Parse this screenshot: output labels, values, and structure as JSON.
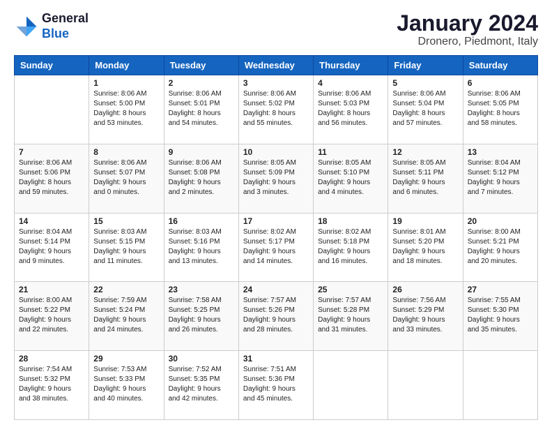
{
  "logo": {
    "line1": "General",
    "line2": "Blue"
  },
  "title": "January 2024",
  "subtitle": "Dronero, Piedmont, Italy",
  "days_header": [
    "Sunday",
    "Monday",
    "Tuesday",
    "Wednesday",
    "Thursday",
    "Friday",
    "Saturday"
  ],
  "weeks": [
    [
      {
        "day": "",
        "info": ""
      },
      {
        "day": "1",
        "info": "Sunrise: 8:06 AM\nSunset: 5:00 PM\nDaylight: 8 hours\nand 53 minutes."
      },
      {
        "day": "2",
        "info": "Sunrise: 8:06 AM\nSunset: 5:01 PM\nDaylight: 8 hours\nand 54 minutes."
      },
      {
        "day": "3",
        "info": "Sunrise: 8:06 AM\nSunset: 5:02 PM\nDaylight: 8 hours\nand 55 minutes."
      },
      {
        "day": "4",
        "info": "Sunrise: 8:06 AM\nSunset: 5:03 PM\nDaylight: 8 hours\nand 56 minutes."
      },
      {
        "day": "5",
        "info": "Sunrise: 8:06 AM\nSunset: 5:04 PM\nDaylight: 8 hours\nand 57 minutes."
      },
      {
        "day": "6",
        "info": "Sunrise: 8:06 AM\nSunset: 5:05 PM\nDaylight: 8 hours\nand 58 minutes."
      }
    ],
    [
      {
        "day": "7",
        "info": "Sunrise: 8:06 AM\nSunset: 5:06 PM\nDaylight: 8 hours\nand 59 minutes."
      },
      {
        "day": "8",
        "info": "Sunrise: 8:06 AM\nSunset: 5:07 PM\nDaylight: 9 hours\nand 0 minutes."
      },
      {
        "day": "9",
        "info": "Sunrise: 8:06 AM\nSunset: 5:08 PM\nDaylight: 9 hours\nand 2 minutes."
      },
      {
        "day": "10",
        "info": "Sunrise: 8:05 AM\nSunset: 5:09 PM\nDaylight: 9 hours\nand 3 minutes."
      },
      {
        "day": "11",
        "info": "Sunrise: 8:05 AM\nSunset: 5:10 PM\nDaylight: 9 hours\nand 4 minutes."
      },
      {
        "day": "12",
        "info": "Sunrise: 8:05 AM\nSunset: 5:11 PM\nDaylight: 9 hours\nand 6 minutes."
      },
      {
        "day": "13",
        "info": "Sunrise: 8:04 AM\nSunset: 5:12 PM\nDaylight: 9 hours\nand 7 minutes."
      }
    ],
    [
      {
        "day": "14",
        "info": "Sunrise: 8:04 AM\nSunset: 5:14 PM\nDaylight: 9 hours\nand 9 minutes."
      },
      {
        "day": "15",
        "info": "Sunrise: 8:03 AM\nSunset: 5:15 PM\nDaylight: 9 hours\nand 11 minutes."
      },
      {
        "day": "16",
        "info": "Sunrise: 8:03 AM\nSunset: 5:16 PM\nDaylight: 9 hours\nand 13 minutes."
      },
      {
        "day": "17",
        "info": "Sunrise: 8:02 AM\nSunset: 5:17 PM\nDaylight: 9 hours\nand 14 minutes."
      },
      {
        "day": "18",
        "info": "Sunrise: 8:02 AM\nSunset: 5:18 PM\nDaylight: 9 hours\nand 16 minutes."
      },
      {
        "day": "19",
        "info": "Sunrise: 8:01 AM\nSunset: 5:20 PM\nDaylight: 9 hours\nand 18 minutes."
      },
      {
        "day": "20",
        "info": "Sunrise: 8:00 AM\nSunset: 5:21 PM\nDaylight: 9 hours\nand 20 minutes."
      }
    ],
    [
      {
        "day": "21",
        "info": "Sunrise: 8:00 AM\nSunset: 5:22 PM\nDaylight: 9 hours\nand 22 minutes."
      },
      {
        "day": "22",
        "info": "Sunrise: 7:59 AM\nSunset: 5:24 PM\nDaylight: 9 hours\nand 24 minutes."
      },
      {
        "day": "23",
        "info": "Sunrise: 7:58 AM\nSunset: 5:25 PM\nDaylight: 9 hours\nand 26 minutes."
      },
      {
        "day": "24",
        "info": "Sunrise: 7:57 AM\nSunset: 5:26 PM\nDaylight: 9 hours\nand 28 minutes."
      },
      {
        "day": "25",
        "info": "Sunrise: 7:57 AM\nSunset: 5:28 PM\nDaylight: 9 hours\nand 31 minutes."
      },
      {
        "day": "26",
        "info": "Sunrise: 7:56 AM\nSunset: 5:29 PM\nDaylight: 9 hours\nand 33 minutes."
      },
      {
        "day": "27",
        "info": "Sunrise: 7:55 AM\nSunset: 5:30 PM\nDaylight: 9 hours\nand 35 minutes."
      }
    ],
    [
      {
        "day": "28",
        "info": "Sunrise: 7:54 AM\nSunset: 5:32 PM\nDaylight: 9 hours\nand 38 minutes."
      },
      {
        "day": "29",
        "info": "Sunrise: 7:53 AM\nSunset: 5:33 PM\nDaylight: 9 hours\nand 40 minutes."
      },
      {
        "day": "30",
        "info": "Sunrise: 7:52 AM\nSunset: 5:35 PM\nDaylight: 9 hours\nand 42 minutes."
      },
      {
        "day": "31",
        "info": "Sunrise: 7:51 AM\nSunset: 5:36 PM\nDaylight: 9 hours\nand 45 minutes."
      },
      {
        "day": "",
        "info": ""
      },
      {
        "day": "",
        "info": ""
      },
      {
        "day": "",
        "info": ""
      }
    ]
  ]
}
